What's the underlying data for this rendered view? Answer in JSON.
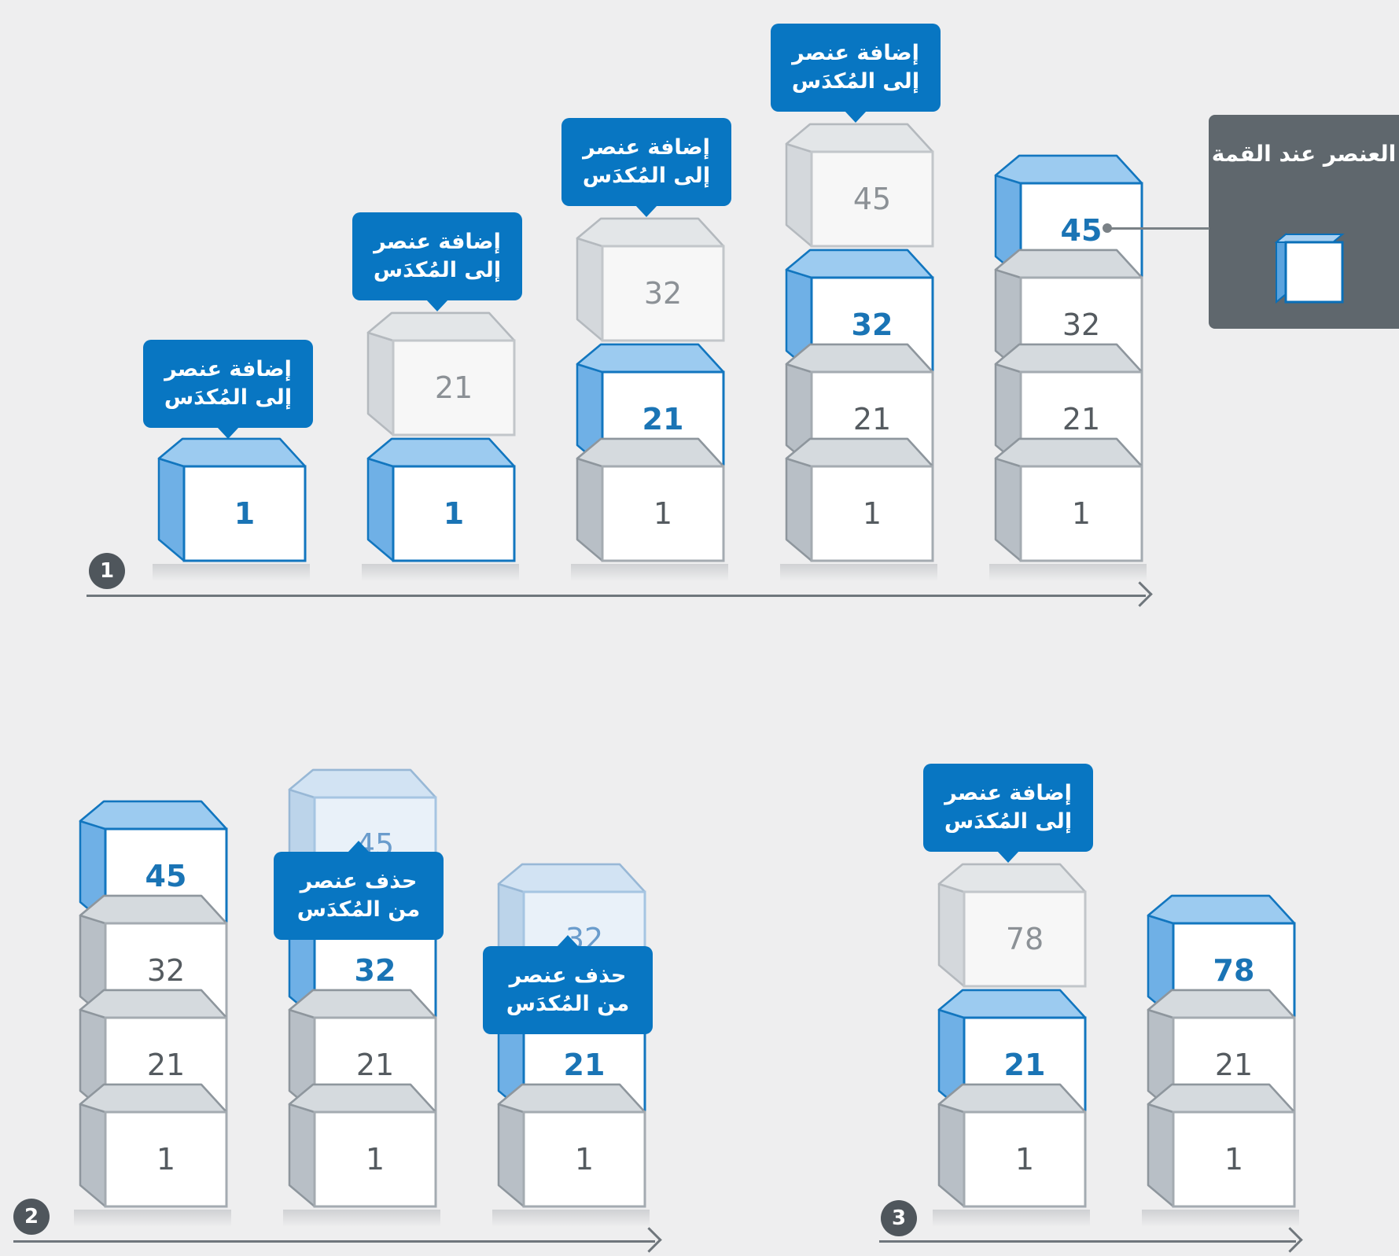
{
  "callouts": {
    "push": [
      "إضافة عنصر",
      "إلى المُكدَس"
    ],
    "pop": [
      "حذف عنصر",
      "من المُكدَس"
    ]
  },
  "top_label": "العنصر عند القمة",
  "steps": [
    "1",
    "2",
    "3"
  ],
  "colors": {
    "blue": "#0876c2",
    "panel": "#5f676d",
    "background": "#eeeeef"
  },
  "scenes": [
    {
      "step": "1",
      "columns": [
        {
          "stack": [
            "1"
          ],
          "floating": null,
          "callout": "push"
        },
        {
          "stack": [
            "1"
          ],
          "floating": "21",
          "callout": "push"
        },
        {
          "stack": [
            "1",
            "21"
          ],
          "floating": "32",
          "callout": "push"
        },
        {
          "stack": [
            "1",
            "21",
            "32"
          ],
          "floating": "45",
          "callout": "push"
        },
        {
          "stack": [
            "1",
            "21",
            "32",
            "45"
          ],
          "floating": null,
          "callout": null
        }
      ]
    },
    {
      "step": "2",
      "columns": [
        {
          "stack": [
            "1",
            "21",
            "32",
            "45"
          ],
          "floating": null,
          "callout": null
        },
        {
          "stack": [
            "1",
            "21",
            "32"
          ],
          "floating": "45",
          "callout": "pop"
        },
        {
          "stack": [
            "1",
            "21"
          ],
          "floating": "32",
          "callout": "pop"
        }
      ]
    },
    {
      "step": "3",
      "columns": [
        {
          "stack": [
            "1",
            "21"
          ],
          "floating": "78",
          "callout": "push"
        },
        {
          "stack": [
            "1",
            "21",
            "78"
          ],
          "floating": null,
          "callout": null
        }
      ]
    }
  ]
}
